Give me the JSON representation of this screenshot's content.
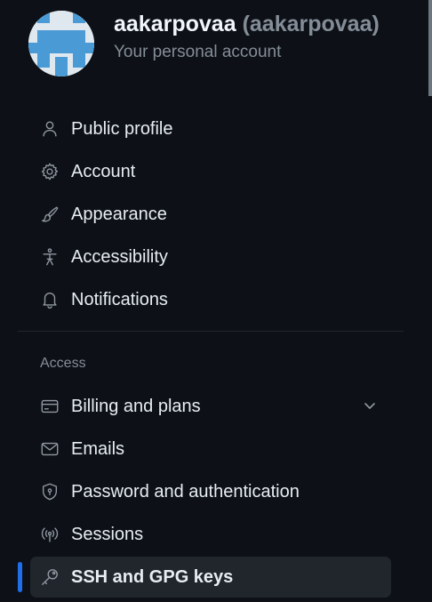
{
  "account": {
    "name": "aakarpovaa",
    "handle": "(aakarpovaa)",
    "subtitle": "Your personal account"
  },
  "nav": {
    "public_profile": "Public profile",
    "account": "Account",
    "appearance": "Appearance",
    "accessibility": "Accessibility",
    "notifications": "Notifications",
    "access_heading": "Access",
    "billing": "Billing and plans",
    "emails": "Emails",
    "password": "Password and authentication",
    "sessions": "Sessions",
    "ssh": "SSH and GPG keys"
  },
  "icons": {
    "public_profile": "person-icon",
    "account": "gear-icon",
    "appearance": "paintbrush-icon",
    "accessibility": "accessibility-icon",
    "notifications": "bell-icon",
    "billing": "credit-card-icon",
    "emails": "mail-icon",
    "password": "shield-lock-icon",
    "sessions": "broadcast-icon",
    "ssh": "key-icon",
    "billing_expand": "chevron-down-icon"
  },
  "colors": {
    "background": "#0d1117",
    "active_item": "#21262d",
    "active_indicator": "#1f6feb",
    "muted_text": "#848d97",
    "text": "#e6edf3"
  },
  "active_item": "SSH and GPG keys"
}
